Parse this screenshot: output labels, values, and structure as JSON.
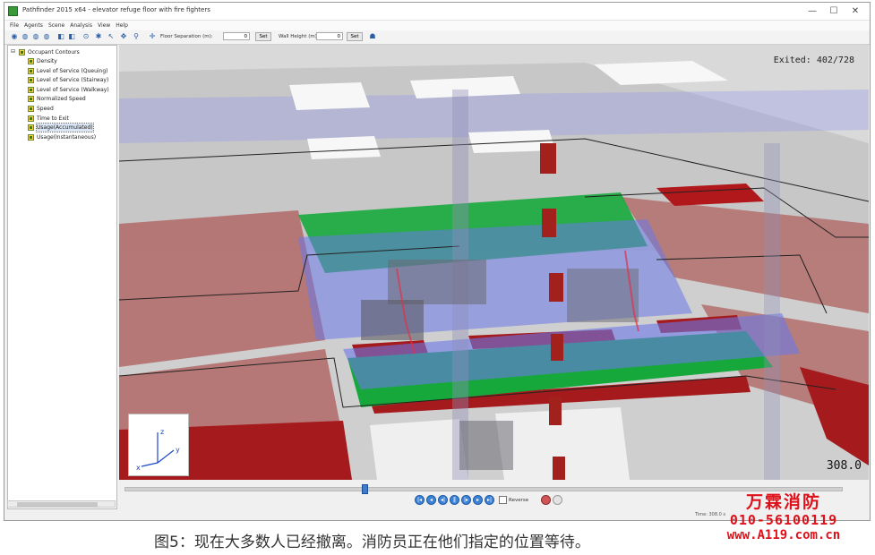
{
  "window": {
    "title": "Pathfinder 2015 x64 - elevator refuge floor with fire fighters",
    "controls": [
      "—",
      "☐",
      "✕"
    ]
  },
  "menu": [
    "File",
    "Agents",
    "Scene",
    "Analysis",
    "View",
    "Help"
  ],
  "toolbar": {
    "floor_separation_label": "Floor Separation (m):",
    "floor_separation_value": "0",
    "wall_height_label": "Wall Height (m):",
    "wall_height_value": "0",
    "set_label": "Set"
  },
  "tree": {
    "root": "Occupant Contours",
    "items": [
      "Density",
      "Level of Service (Queuing)",
      "Level of Service (Stairway)",
      "Level of Service (Walkway)",
      "Normalized Speed",
      "Speed",
      "Time to Exit",
      "Usage(Accumulated)",
      "Usage(Instantaneous)"
    ],
    "selected_index": 7
  },
  "viewport": {
    "exited_text": "Exited: 402/728",
    "time_text": "308.0",
    "axis_labels": [
      "z",
      "y",
      "x"
    ]
  },
  "playback": {
    "timeline_fraction": 0.33,
    "reverse_label": "Reverse",
    "buttons": [
      "first",
      "play-back",
      "step-back",
      "pause",
      "step-forward",
      "play",
      "last"
    ]
  },
  "status": {
    "text": "Time: 308.0 s"
  },
  "watermark": {
    "brand": "万霖消防",
    "phone": "010-56100119",
    "url": "www.A119.com.cn"
  },
  "caption": "图5：现在大多数人已经撤离。消防员正在他们指定的位置等待。",
  "colors": {
    "floor_gray": "#c9c9c9",
    "zone_red": "#b4312f",
    "zone_pink": "#b26e6c",
    "zone_green": "#17a83c",
    "path_blue": "#5a6ef0",
    "path_pink": "#e06fb4",
    "watermark_red": "#e0101a"
  }
}
